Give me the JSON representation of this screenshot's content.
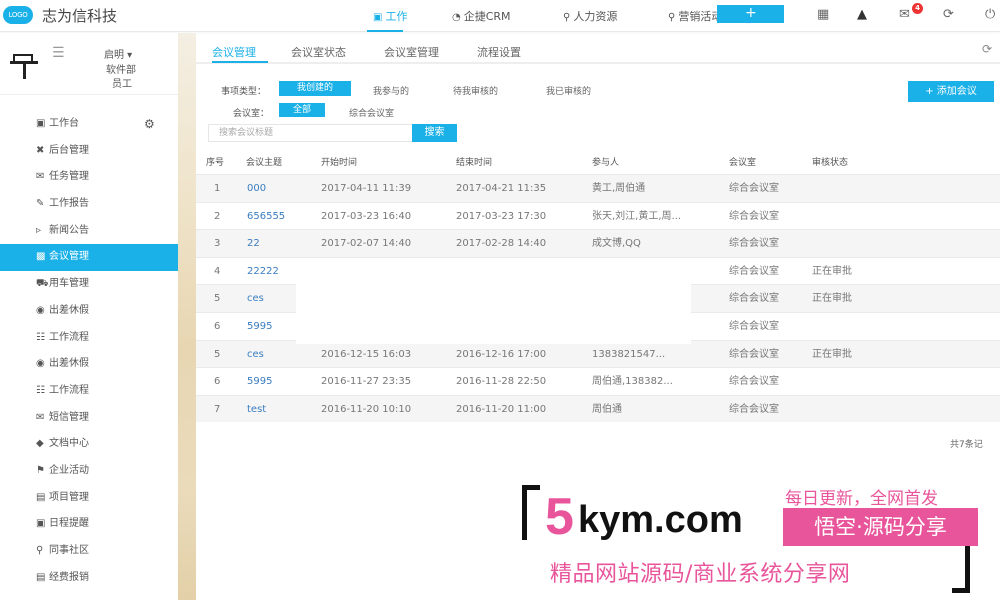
{
  "header": {
    "logo_text": "LOGO",
    "brand": "志为信科技",
    "nav": [
      {
        "label": "工作",
        "icon": "briefcase-icon",
        "active": true
      },
      {
        "label": "企捷CRM",
        "icon": "pie-chart-icon",
        "active": false
      },
      {
        "label": "人力资源",
        "icon": "users-icon",
        "active": false
      },
      {
        "label": "营销活动",
        "icon": "users-icon",
        "active": false
      }
    ],
    "plus_label": "+",
    "icons": [
      "qrcode-icon",
      "shirt-icon",
      "mail-icon",
      "refresh-icon",
      "power-icon"
    ],
    "mail_badge": "4"
  },
  "sidebar": {
    "user": {
      "name": "启明 ▾",
      "department": "软件部",
      "role": "员工"
    },
    "items": [
      {
        "label": "工作台",
        "icon": "briefcase-icon"
      },
      {
        "label": "后台管理",
        "icon": "tools-icon"
      },
      {
        "label": "任务管理",
        "icon": "envelope-check-icon"
      },
      {
        "label": "工作报告",
        "icon": "edit-icon"
      },
      {
        "label": "新闻公告",
        "icon": "megaphone-icon"
      },
      {
        "label": "会议管理",
        "icon": "group-icon",
        "active": true
      },
      {
        "label": "用车管理",
        "icon": "car-icon"
      },
      {
        "label": "出差休假",
        "icon": "location-icon"
      },
      {
        "label": "工作流程",
        "icon": "sitemap-icon"
      },
      {
        "label": "出差休假",
        "icon": "location-icon"
      },
      {
        "label": "工作流程",
        "icon": "sitemap-icon"
      },
      {
        "label": "短信管理",
        "icon": "sms-icon"
      },
      {
        "label": "文档中心",
        "icon": "layers-icon"
      },
      {
        "label": "企业活动",
        "icon": "flag-icon"
      },
      {
        "label": "项目管理",
        "icon": "project-icon"
      },
      {
        "label": "日程提醒",
        "icon": "calendar-icon"
      },
      {
        "label": "同事社区",
        "icon": "community-icon"
      },
      {
        "label": "经费报销",
        "icon": "receipt-icon"
      }
    ]
  },
  "main": {
    "tabs": [
      "会议管理",
      "会议室状态",
      "会议室管理",
      "流程设置"
    ],
    "filters": {
      "type_label": "事项类型：",
      "type_options": [
        "我创建的",
        "我参与的",
        "待我审核的",
        "我已审核的"
      ],
      "room_label": "会议室：",
      "room_options": [
        "全部",
        "综合会议室"
      ]
    },
    "add_button": "+ 添加会议",
    "search": {
      "placeholder": "搜索会议标题",
      "button": "搜索"
    },
    "table": {
      "columns": [
        "序号",
        "会议主题",
        "开始时间",
        "结束时间",
        "参与人",
        "会议室",
        "审核状态"
      ],
      "rows": [
        [
          "1",
          "000",
          "2017-04-11 11:39",
          "2017-04-21 11:35",
          "黄工,周伯通",
          "综合会议室",
          ""
        ],
        [
          "2",
          "656555",
          "2017-03-23 16:40",
          "2017-03-23 17:30",
          "张天,刘江,黄工,周...",
          "综合会议室",
          ""
        ],
        [
          "3",
          "22",
          "2017-02-07 14:40",
          "2017-02-28 14:40",
          "成文博,QQ",
          "综合会议室",
          ""
        ],
        [
          "4",
          "22222",
          "",
          "",
          "",
          "综合会议室",
          "正在审批"
        ],
        [
          "5",
          "ces",
          "",
          "",
          "",
          "综合会议室",
          "正在审批"
        ],
        [
          "6",
          "5995",
          "",
          "",
          "",
          "综合会议室",
          ""
        ],
        [
          "5",
          "ces",
          "2016-12-15 16:03",
          "2016-12-16 17:00",
          "1383821547...",
          "综合会议室",
          "正在审批"
        ],
        [
          "6",
          "5995",
          "2016-11-27 23:35",
          "2016-11-28 22:50",
          "周伯通,138382...",
          "综合会议室",
          ""
        ],
        [
          "7",
          "test",
          "2016-11-20 10:10",
          "2016-11-20 11:00",
          "周伯通",
          "综合会议室",
          ""
        ]
      ]
    },
    "total": "共7条记"
  },
  "watermark": {
    "five": "5",
    "domain": "kym.com",
    "slogan_top": "每日更新，全网首发",
    "slogan_box": "悟空·源码分享",
    "slogan_bottom": "精品网站源码/商业系统分享网"
  },
  "colors": {
    "accent": "#1ab0e8",
    "link": "#3a7dc0",
    "badge": "#ee3333",
    "watermark_pink": "#e8559b"
  }
}
